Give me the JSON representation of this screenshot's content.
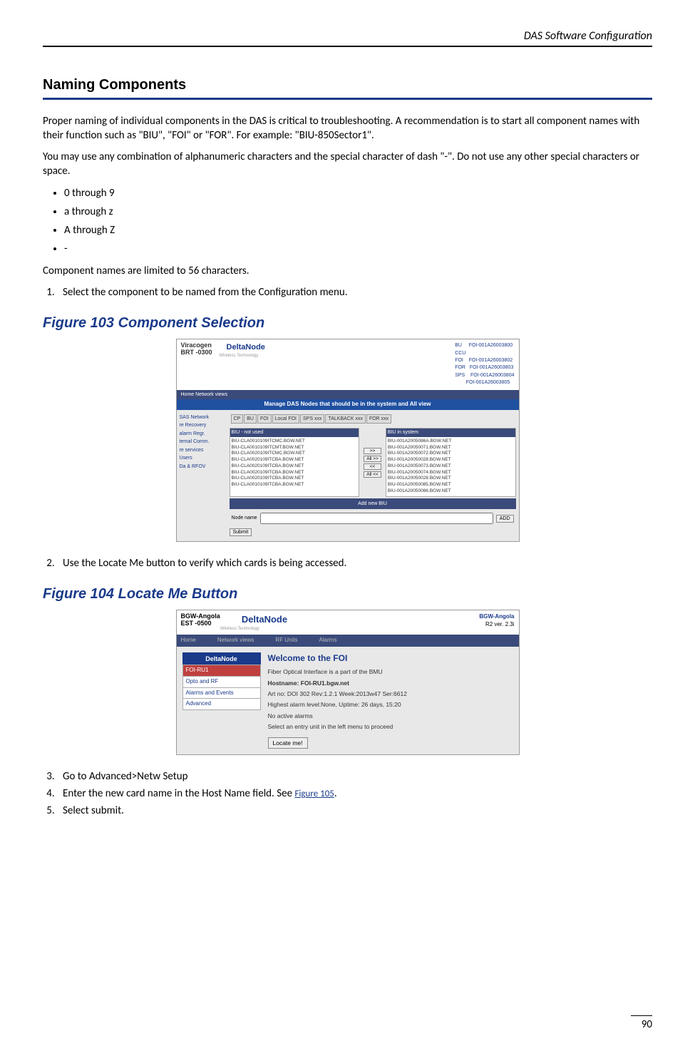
{
  "header": {
    "running_title": "DAS Software Configuration"
  },
  "section_title": "Naming Components",
  "para1": "Proper naming of individual components in the DAS is critical to troubleshooting.  A recommendation is to start all component names with their function such as \"BIU\", \"FOI\" or \"FOR\".  For example: \"BIU-850Sector1\".",
  "para2": "You may use any combination of alphanumeric characters and the special character of dash \"-\".  Do not use any other special characters or space.",
  "bullets": [
    "0 through 9",
    "a through z",
    "A through Z",
    "-"
  ],
  "para3": "Component names are limited to 56 characters.",
  "step1": "Select the component to be named from the Configuration menu.",
  "fig103_caption": "Figure 103    Component Selection",
  "step2": "Use the Locate Me button to verify which cards is being accessed.",
  "fig104_caption": "Figure 104    Locate Me Button",
  "step3": "Go to Advanced>Netw Setup",
  "step4_pre": "Enter the new card name in the Host Name field. See ",
  "step4_link": "Figure 105",
  "step4_post": ".",
  "step5": "Select submit.",
  "page_number": "90",
  "fig103": {
    "time1": "Viracogen",
    "time2": "BRT -0300",
    "logo": "DeltaNode",
    "logosub": "Wireless Technology",
    "rightlinks": [
      "FOI-001A26003800",
      "FOI-001A26003802",
      "FOI-001A26003803",
      "FOI-001A26003804",
      "FOI-001A26003805"
    ],
    "rightlabels": [
      "BU",
      "CCU",
      "FOI",
      "FOR",
      "SPS"
    ],
    "tabs": "Home      Network views",
    "bluebar": "Manage DAS Nodes that should be in the system and All view",
    "sidebar": [
      "SAS Network",
      "re Recovery",
      "alarm Regr.",
      "ternal Comm.",
      "re services",
      "Users",
      "Da & RFOV"
    ],
    "subtabs": [
      "CP",
      "BU",
      "FOI",
      "Local FOI",
      "SPS xxx",
      "TALKBACK xxx",
      "FOR xxx"
    ],
    "col1h": "BIU - not used",
    "col2h": "BIU in system",
    "list1": [
      "BIU-CLA0010109ITCMC.BGW.NET",
      "BIU-CLA0010109ITCMT.BGW.NET",
      "BIU-CLA0020109ITCMC.BGW.NET",
      "BIU-CLA0020109ITCBA.BGW.NET",
      "BIU-CLA0020109ITCBA.BGW.NET",
      "BIU-CLA0020109ITCBA.BGW.NET",
      "BIU-CLA0020109ITCBA.BGW.NET",
      "BIU-CLA0010109ITCBA.BGW.NET"
    ],
    "list2": [
      "BIU-001A2005086A.BGW.NET",
      "BIU-001A20050071.BGW.NET",
      "BIU-001A20050072.BGW.NET",
      "BIU-001A20050028.BGW.NET",
      "BIU-001A20050073.BGW.NET",
      "BIU-001A20050074.BGW.NET",
      "BIU-001A20050028.BGW.NET",
      "BIU-001A20050085.BGW.NET",
      "BIU-001A20050086.BGW.NET"
    ],
    "midbuttons": [
      ">>",
      "All >>",
      "<<",
      "All <<"
    ],
    "addlabel": "Add new BIU",
    "nodelabel": "Node name",
    "addbtn": "ADD",
    "submit": "Submit"
  },
  "fig104": {
    "tl1": "BGW-Angola",
    "tl2": "EST -0500",
    "logo": "DeltaNode",
    "logosub": "Wireless  Technology",
    "rtname": "BGW-Angola",
    "rtver": "R2 ver. 2.3i",
    "menu": [
      "Home",
      "Network views",
      "RF Units",
      "Alarms"
    ],
    "side_logo": "DeltaNode",
    "side_items": [
      "FOI-RU1",
      "Opto and RF",
      "Alarms and Events",
      "Advanced"
    ],
    "welcome": "Welcome to the FOI",
    "l1": "Fiber Optical Interface is a part of the BMU",
    "l2": "Hostname: FOI-RU1.bgw.net",
    "l3": "Art no: DOI 302 Rev:1.2.1 Week:2013w47 Ser:6612",
    "l4": "Highest alarm level:None,  Uptime: 26 days, 15:20",
    "l5": "No active alarms",
    "l6": "Select an entry unit in the left menu to proceed",
    "locbtn": "Locate me!"
  }
}
